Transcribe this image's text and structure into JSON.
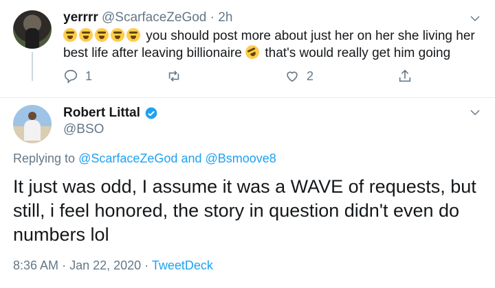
{
  "reply": {
    "display_name": "yerrrr",
    "handle": "@ScarfaceZeGod",
    "separator": "·",
    "time": "2h",
    "text_part1": "you should post more about just her on her she living her best life after leaving billionaire",
    "text_part2": "that's would really get him going",
    "emoji_prefix": [
      "loudly-crying-face",
      "loudly-crying-face",
      "loudly-crying-face",
      "loudly-crying-face",
      "loudly-crying-face"
    ],
    "emoji_inline": "rolling-on-floor-laughing",
    "reply_count": "1",
    "retweet_count": "",
    "like_count": "2"
  },
  "tweet": {
    "display_name": "Robert Littal",
    "handle": "@BSO",
    "replying_label": "Replying to",
    "reply_to_1": "@ScarfaceZeGod",
    "reply_and": "and",
    "reply_to_2": "@Bsmoove8",
    "text": "It just was odd, I assume it was a WAVE of requests, but still, i feel honored, the story in question didn't even do numbers lol",
    "time": "8:36 AM",
    "dot": "·",
    "date": "Jan 22, 2020",
    "source": "TweetDeck"
  },
  "colors": {
    "link": "#1da1f2",
    "muted": "#657786",
    "text": "#14171a",
    "divider": "#e6ecf0",
    "verified": "#1da1f2"
  }
}
